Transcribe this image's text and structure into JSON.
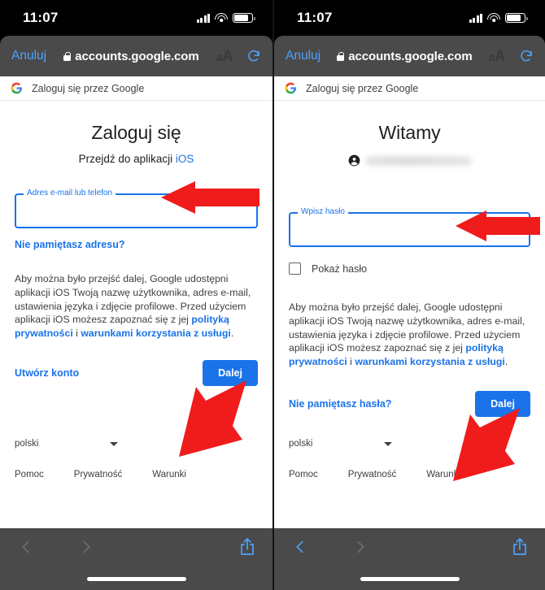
{
  "status_bar": {
    "time": "11:07",
    "signal_icon": "cellular-signal-icon",
    "wifi_icon": "wifi-icon",
    "battery_icon": "battery-icon"
  },
  "browser": {
    "cancel_label": "Anuluj",
    "url": "accounts.google.com",
    "lock_icon": "lock-icon",
    "text_size_label": "AA",
    "reload_icon": "reload-icon",
    "back_icon": "chevron-left-icon",
    "forward_icon": "chevron-right-icon",
    "share_icon": "share-icon"
  },
  "google_header": {
    "logo": "google-g-logo",
    "label": "Zaloguj się przez Google"
  },
  "left_panel": {
    "title": "Zaloguj się",
    "subtitle_prefix": "Przejdź do aplikacji ",
    "subtitle_link": "iOS",
    "field_label": "Adres e-mail lub telefon",
    "field_value": "",
    "forgot_link": "Nie pamiętasz adresu?",
    "body_part1": "Aby można było przejść dalej, Google udostępni aplikacji iOS Twoją nazwę użytkownika, adres e-mail, ustawienia języka i zdjęcie profilowe. Przed użyciem aplikacji iOS możesz zapoznać się z jej ",
    "body_link1": "polityką prywatności",
    "body_mid": " i ",
    "body_link2": "warunkami korzystania z usługi",
    "body_end": ".",
    "create_account": "Utwórz konto",
    "next_button": "Dalej"
  },
  "right_panel": {
    "title": "Witamy",
    "account_avatar_icon": "account-circle-icon",
    "account_email_redacted": "",
    "field_label": "Wpisz hasło",
    "field_value": "",
    "show_password_label": "Pokaż hasło",
    "show_password_checked": false,
    "body_part1": "Aby można było przejść dalej, Google udostępni aplikacji iOS Twoją nazwę użytkownika, adres e-mail, ustawienia języka i zdjęcie profilowe. Przed użyciem aplikacji iOS możesz zapoznać się z jej ",
    "body_link1": "polityką prywatności",
    "body_mid": " i ",
    "body_link2": "warunkami korzystania z usługi",
    "body_end": ".",
    "forgot_password": "Nie pamiętasz hasła?",
    "next_button": "Dalej"
  },
  "footer": {
    "language": "polski",
    "dropdown_icon": "chevron-down-icon",
    "links": [
      "Pomoc",
      "Prywatność",
      "Warunki"
    ]
  },
  "annotations": {
    "arrow_color": "#F01C1C",
    "items": [
      {
        "name": "arrow-to-email-field",
        "direction": "left"
      },
      {
        "name": "arrow-to-left-next-button",
        "direction": "up-right"
      },
      {
        "name": "arrow-to-password-field",
        "direction": "left"
      },
      {
        "name": "arrow-to-right-next-button",
        "direction": "up-right"
      }
    ]
  },
  "colors": {
    "accent_blue": "#1A73E8",
    "ios_blue": "#4DA2FF",
    "chrome_gray": "#4A4A4A",
    "text": "#3C4043"
  }
}
